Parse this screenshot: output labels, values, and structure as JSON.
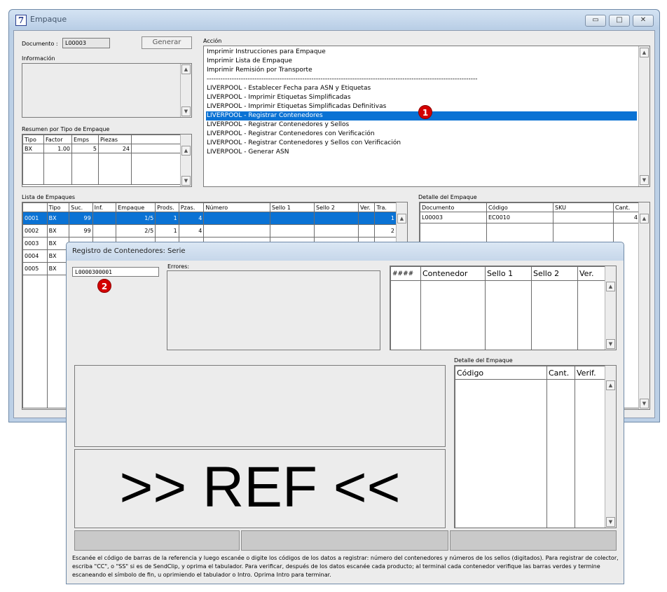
{
  "window": {
    "title": "Empaque",
    "icon_glyph": "7",
    "controls": [
      "minimize-icon",
      "maximize-icon",
      "close-icon"
    ],
    "minimize_glyph": "▭",
    "maximize_glyph": "□",
    "close_glyph": "✕"
  },
  "documento": {
    "label": "Documento :",
    "value": "L00003"
  },
  "generar_label": "Generar",
  "informacion_label": "Información",
  "resumen": {
    "label": "Resumen por Tipo de Empaque",
    "columns": [
      "Tipo",
      "Factor",
      "Emps",
      "Piezas"
    ],
    "rows": [
      {
        "tipo": "BX",
        "factor": "1.00",
        "emps": "5",
        "piezas": "24"
      }
    ]
  },
  "accion": {
    "label": "Acción",
    "items": [
      "Imprimir Instrucciones para Empaque",
      "Imprimir Lista de Empaque",
      "Imprimir Remisión por Transporte",
      "-----------------------------------------------------------------------------------------------------------------------",
      "LIVERPOOL - Establecer Fecha para ASN y Etiquetas",
      "LIVERPOOL - Imprimir Etiquetas Simplificadas",
      "LIVERPOOL - Imprimir Etiquetas Simplificadas Definitivas",
      "LIVERPOOL - Registrar Contenedores",
      "LIVERPOOL - Registrar Contenedores y Sellos",
      "LIVERPOOL - Registrar Contenedores con Verificación",
      "LIVERPOOL - Registrar Contenedores y Sellos con Verificación",
      "LIVERPOOL - Generar ASN"
    ],
    "selected_index": 7
  },
  "markers": {
    "m1": "1",
    "m2": "2"
  },
  "lista": {
    "label": "Lista de Empaques",
    "columns": [
      "",
      "Tipo",
      "Suc.",
      "Inf.",
      "Empaque",
      "Prods.",
      "Pzas.",
      "Número",
      "Sello 1",
      "Sello 2",
      "Ver.",
      "Tra."
    ],
    "rows": [
      {
        "id": "0001",
        "tipo": "BX",
        "suc": "99",
        "inf": "",
        "empaque": "1/5",
        "prods": "1",
        "pzas": "4",
        "tra": "1"
      },
      {
        "id": "0002",
        "tipo": "BX",
        "suc": "99",
        "inf": "",
        "empaque": "2/5",
        "prods": "1",
        "pzas": "4",
        "tra": "2"
      },
      {
        "id": "0003",
        "tipo": "BX"
      },
      {
        "id": "0004",
        "tipo": "BX"
      },
      {
        "id": "0005",
        "tipo": "BX"
      }
    ]
  },
  "detalle": {
    "label": "Detalle del Empaque",
    "columns": [
      "Documento",
      "Código",
      "SKU",
      "Cant."
    ],
    "rows": [
      {
        "documento": "L00003",
        "codigo": "EC0010",
        "sku": "",
        "cant": "4"
      }
    ]
  },
  "dialog": {
    "title": "Registro de Contenedores:   Serie",
    "input_value": "L0000300001",
    "errores_label": "Errores:",
    "contenedores_columns": [
      "####",
      "Contenedor",
      "Sello 1",
      "Sello 2",
      "Ver."
    ],
    "detalle_label": "Detalle del Empaque",
    "detalle_columns": [
      "Código",
      "Cant.",
      "Verif."
    ],
    "big_text": ">> REF <<",
    "help_text": "Escanée el código de barras de la referencia y luego escanée o digite los códigos de los datos a registrar: número del contenedores y números de los sellos (digitados). Para registrar de colector, escriba \"CC\", o \"SS\" si es de SendClip, y oprima el tabulador. Para verificar, después de los datos escanée cada producto; al terminal cada contenedor verifique las barras verdes y termine escaneando el símbolo de fin, u oprimiendo el tabulador o Intro. Oprima Intro para terminar."
  },
  "scroll_glyphs": {
    "up": "▲",
    "down": "▼"
  }
}
